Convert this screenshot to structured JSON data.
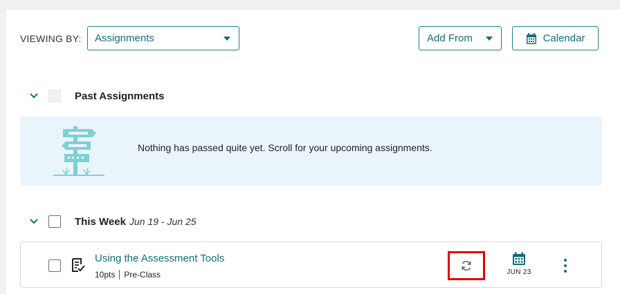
{
  "toolbar": {
    "viewing_by_label": "VIEWING BY:",
    "view_select_value": "Assignments",
    "add_from_label": "Add From",
    "calendar_label": "Calendar"
  },
  "sections": {
    "past": {
      "title": "Past Assignments"
    },
    "this_week": {
      "title": "This Week",
      "range": "Jun 19 - Jun 25"
    }
  },
  "empty_state": {
    "message": "Nothing has passed quite yet. Scroll for your upcoming assignments."
  },
  "assignments": [
    {
      "title": "Using the Assessment Tools",
      "points": "10pts",
      "type": "Pre-Class",
      "due": "JUN 23"
    }
  ],
  "icons": {
    "chevron": "chevron-down-icon",
    "calendar": "calendar-icon",
    "assignment": "assignment-doc-icon",
    "sync": "sync-icon",
    "more": "kebab-icon",
    "signpost": "signpost-icon"
  },
  "colors": {
    "accent": "#136c79",
    "banner_bg": "#eaf5fb",
    "highlight": "#e00000",
    "signpost": "#7fd0d4"
  }
}
